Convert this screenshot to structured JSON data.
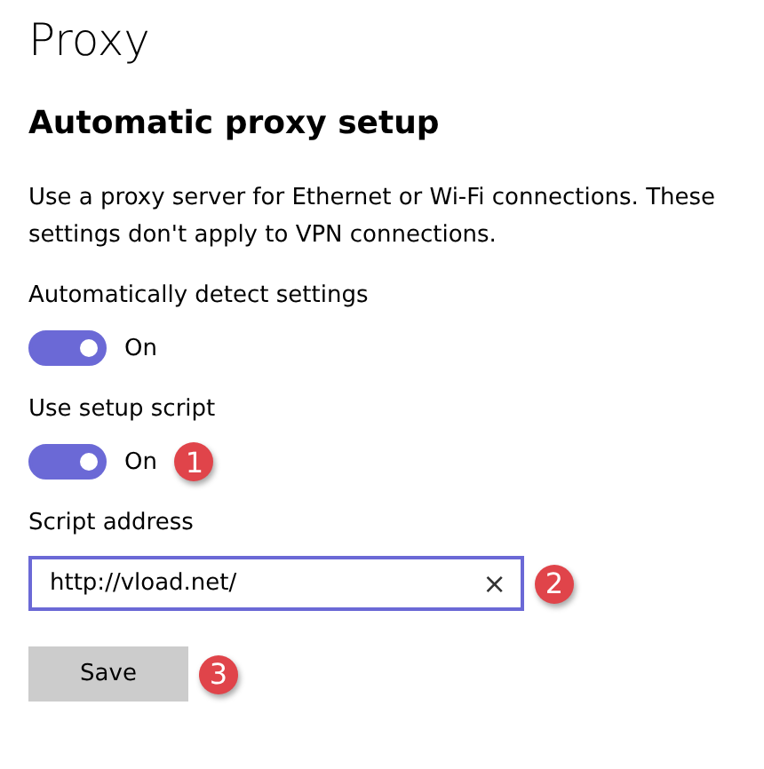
{
  "page_title": "Proxy",
  "section_title": "Automatic proxy setup",
  "description": "Use a proxy server for Ethernet or Wi-Fi connections. These settings don't apply to VPN connections.",
  "settings": [
    {
      "label": "Automatically detect settings",
      "on": true,
      "state_label": "On"
    },
    {
      "label": "Use setup script",
      "on": true,
      "state_label": "On",
      "callout": "1"
    }
  ],
  "script_address": {
    "label": "Script address",
    "value": "http://vload.net/",
    "clear": "×",
    "callout": "2"
  },
  "save_button": {
    "label": "Save",
    "callout": "3"
  }
}
